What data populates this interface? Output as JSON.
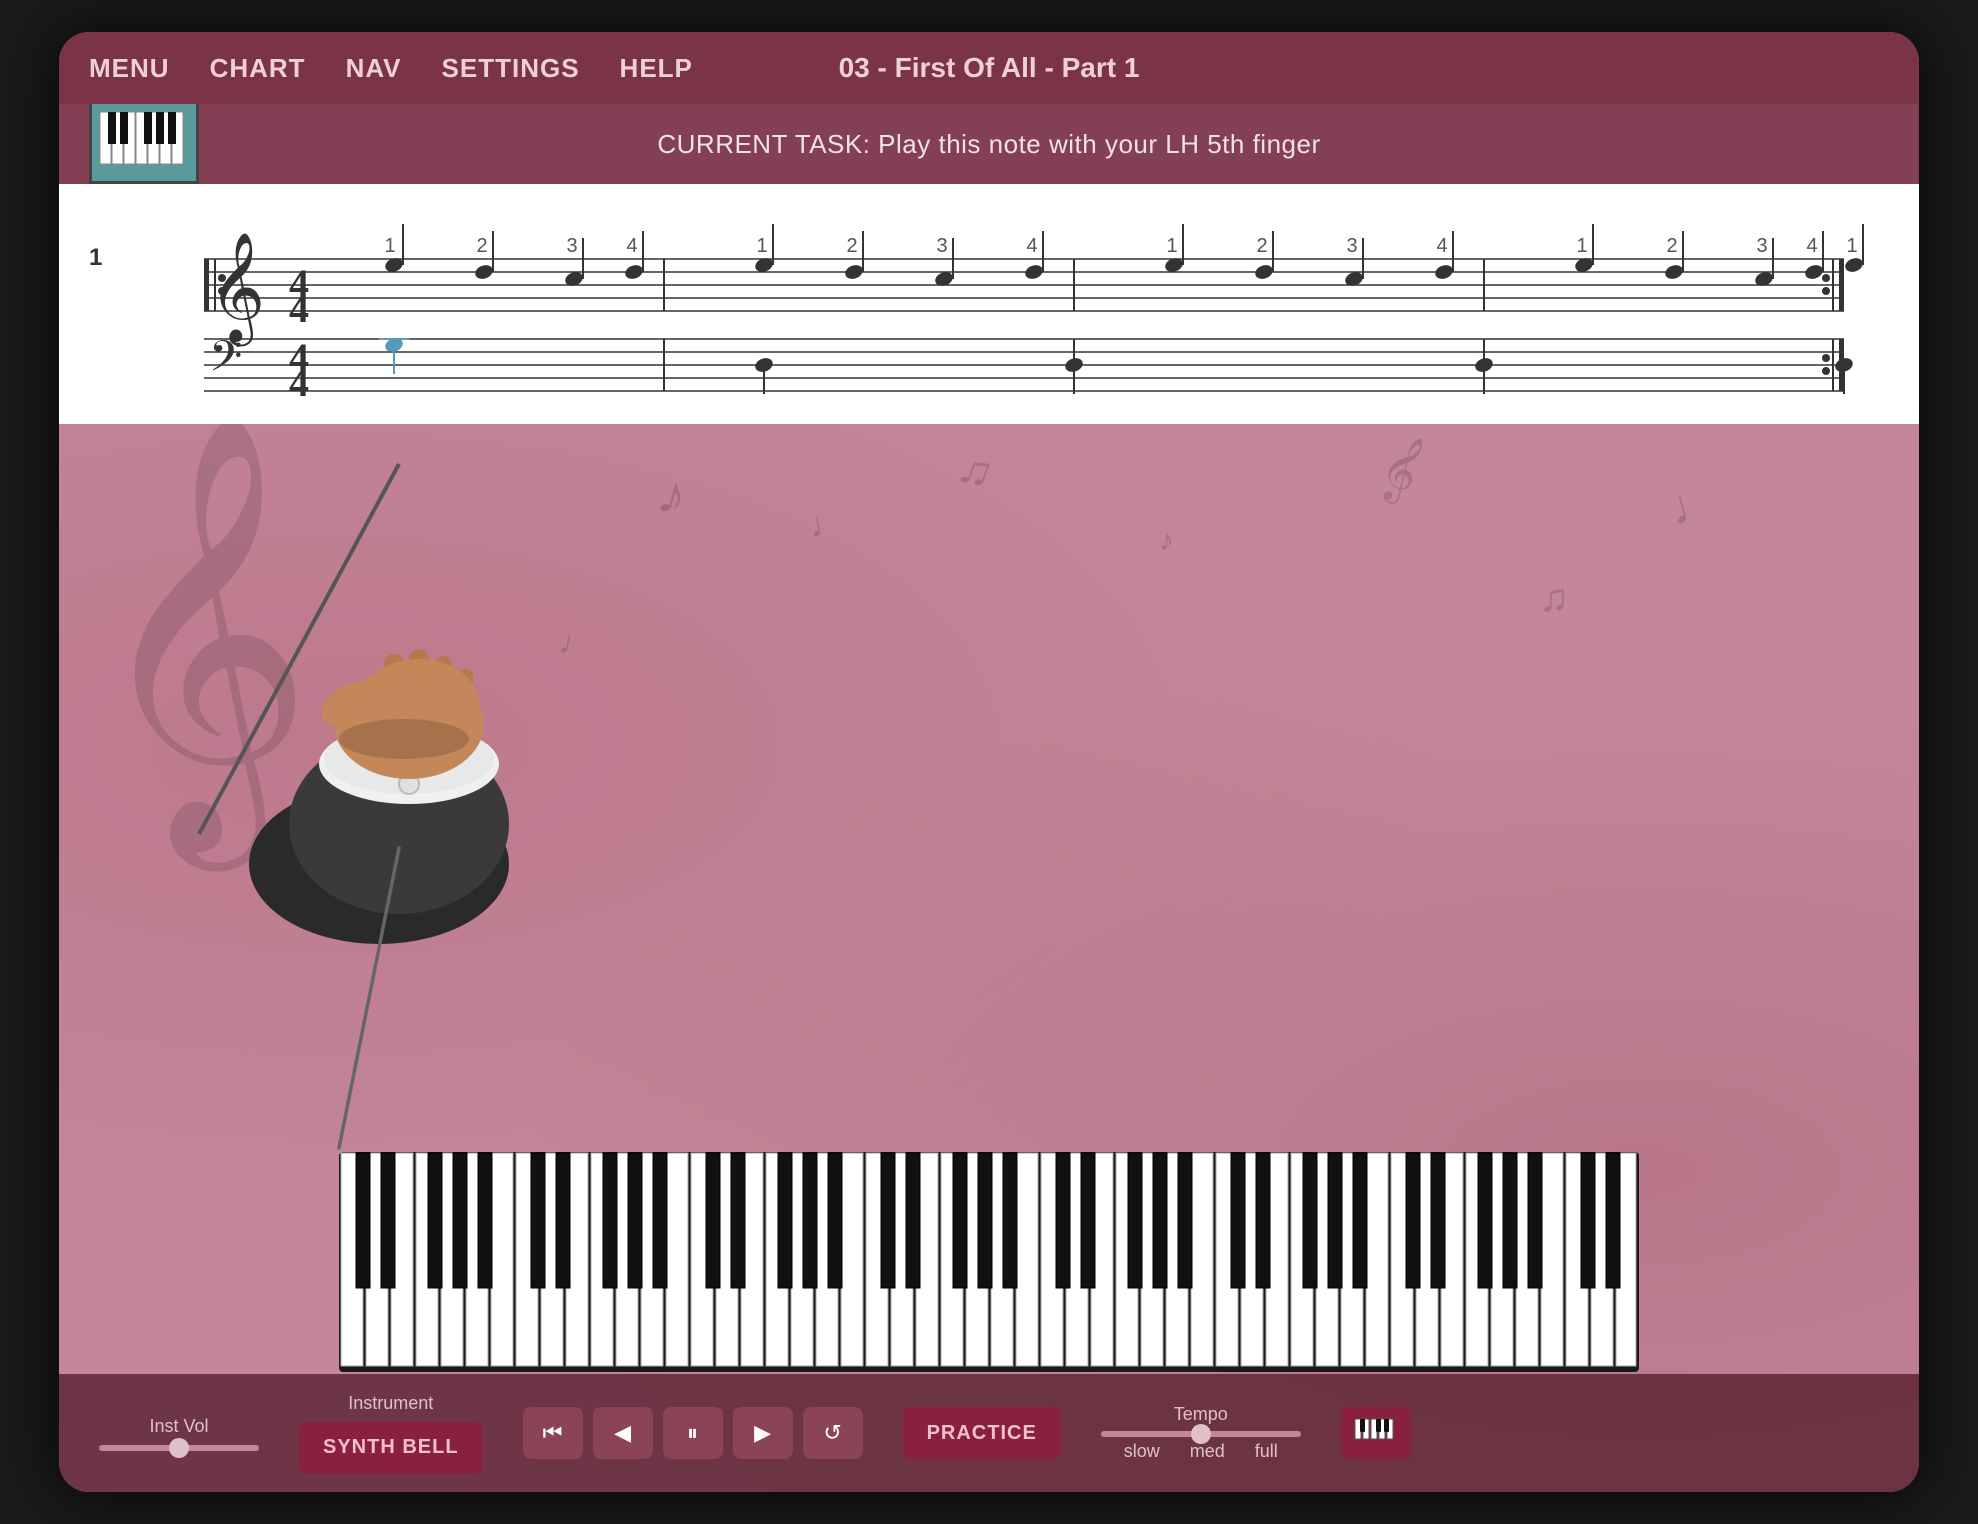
{
  "app": {
    "title": "03 - First Of All - Part 1"
  },
  "menu": {
    "items": [
      "MENU",
      "CHART",
      "NAV",
      "SETTINGS",
      "HELP"
    ]
  },
  "task": {
    "text": "CURRENT TASK: Play this note with your LH 5th finger"
  },
  "sheet": {
    "measure_number": "1",
    "time_signature": "4/4"
  },
  "controls": {
    "inst_vol_label": "Inst Vol",
    "instrument_label": "Instrument",
    "instrument_name": "SYNTH BELL",
    "tempo_label": "Tempo",
    "tempo_slow": "slow",
    "tempo_med": "med",
    "tempo_full": "full",
    "practice_label": "PRACTICE",
    "rewind_icon": "⏮",
    "back_icon": "◀",
    "pause_icon": "⏸",
    "play_icon": "▶",
    "refresh_icon": "↺"
  },
  "beat_numbers": [
    "1",
    "2",
    "3",
    "4",
    "1",
    "2",
    "3",
    "4",
    "1",
    "2",
    "3",
    "4",
    "1",
    "2",
    "3",
    "4",
    "1"
  ],
  "colors": {
    "menu_bg": "#7a3347",
    "task_bg": "#8a4055",
    "main_bg": "#c4879a",
    "sheet_bg": "#ffffff",
    "control_bg": "#501928",
    "button_bg": "#8a2040",
    "piano_icon_bg": "#5a9a9a",
    "accent_blue": "#60a0b0"
  }
}
